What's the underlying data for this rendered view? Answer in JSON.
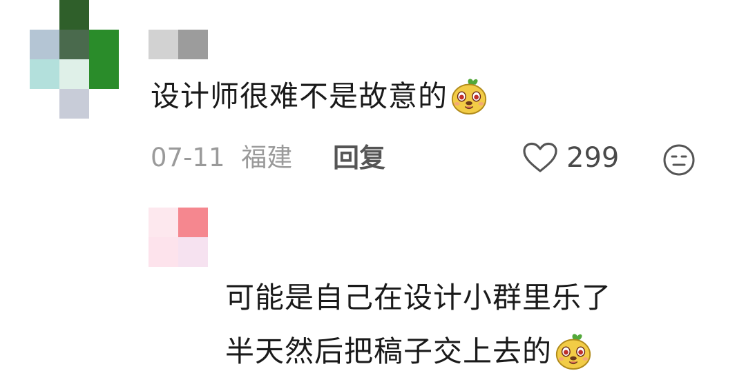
{
  "colors": {
    "text_primary": "#1a1a1a",
    "text_meta": "#9a9a9a",
    "text_action": "#555555",
    "avatar1_pixels": [
      "#2f5f2a",
      "#b4c5d4",
      "#4a6a4d",
      "#2a8c2a",
      "#b3e0dc",
      "#dff0e8",
      "#2a8c2a",
      "#c8ccd8"
    ],
    "name1_pixels": [
      "#d2d2d2",
      "#9c9c9c"
    ],
    "avatar2_pixels": [
      "#fde8ee",
      "#f5878f",
      "#fde3ec",
      "#f6e2f0"
    ]
  },
  "comment1": {
    "text": "设计师很难不是故意的",
    "emoji_icon": "laughing-mascot-icon",
    "date": "07-11",
    "region": "福建",
    "reply_label": "回复",
    "like_count": "299"
  },
  "comment2": {
    "line1": "可能是自己在设计小群里乐了",
    "line2": "半天然后把稿子交上去的",
    "emoji_icon": "laughing-mascot-icon"
  }
}
